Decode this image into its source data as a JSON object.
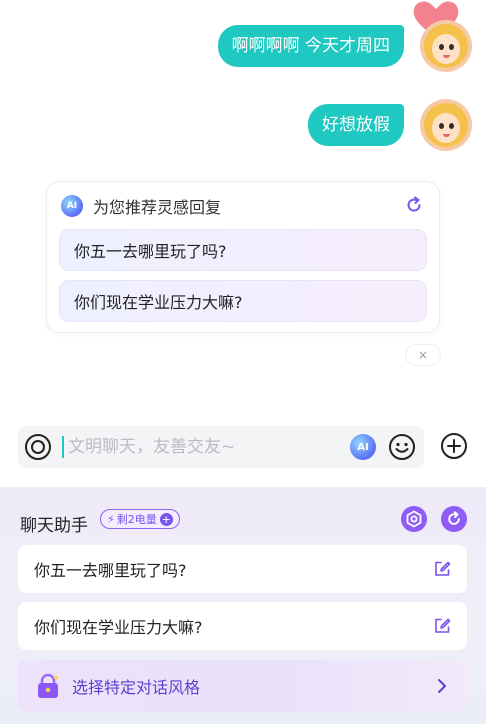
{
  "messages": [
    {
      "text": "啊啊啊啊 今天才周四"
    },
    {
      "text": "好想放假"
    }
  ],
  "suggestions": {
    "title": "为您推荐灵感回复",
    "ai_icon_text": "AI",
    "items": [
      {
        "label": "你五一去哪里玩了吗?"
      },
      {
        "label": "你们现在学业压力大嘛?"
      }
    ],
    "close_label": "×"
  },
  "input": {
    "placeholder": "文明聊天，友善交友~",
    "value": "",
    "ai_button_text": "AI"
  },
  "assistant": {
    "title": "聊天助手",
    "energy_badge": "剩2电量",
    "replies": [
      {
        "label": "你五一去哪里玩了吗?"
      },
      {
        "label": "你们现在学业压力大嘛?"
      }
    ],
    "style_label": "选择特定对话风格"
  },
  "colors": {
    "accent_teal": "#1fc8c1",
    "accent_purple": "#8e5cf7"
  },
  "icons": [
    "heart-icon",
    "ai-icon",
    "refresh-icon",
    "voice-icon",
    "emoji-icon",
    "plus-icon",
    "settings-icon",
    "edit-icon",
    "lock-icon",
    "chevron-right-icon"
  ]
}
